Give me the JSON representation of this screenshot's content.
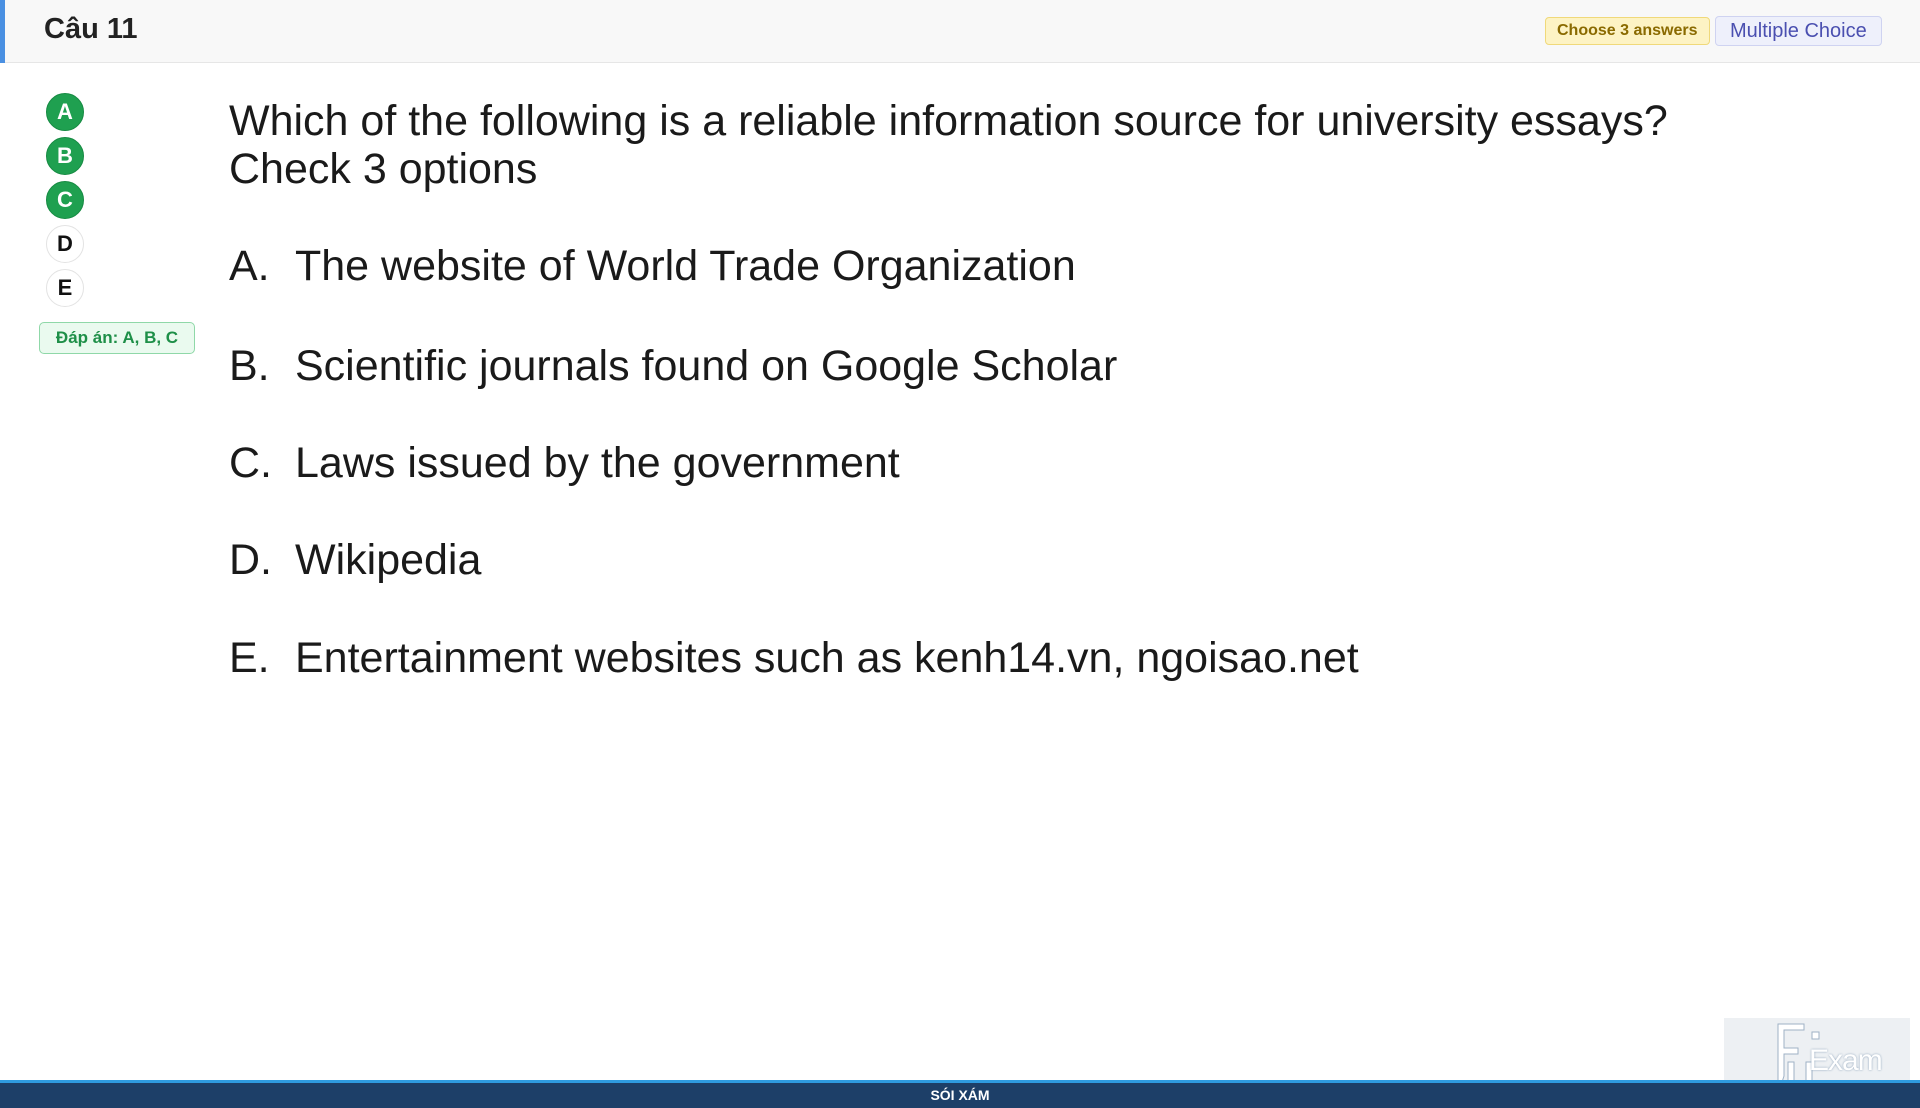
{
  "header": {
    "title": "Câu 11",
    "choose_label": "Choose 3 answers",
    "type_label": "Multiple Choice",
    "accent_color": "#4a90e2"
  },
  "answers": {
    "circles": [
      {
        "letter": "A",
        "selected": true
      },
      {
        "letter": "B",
        "selected": true
      },
      {
        "letter": "C",
        "selected": true
      },
      {
        "letter": "D",
        "selected": false
      },
      {
        "letter": "E",
        "selected": false
      }
    ],
    "badge": "Đáp án: A, B, C",
    "selected_color": "#1fa050"
  },
  "question": {
    "line1": "Which of the following is a reliable information source for university essays?",
    "line2": "Check 3 options",
    "options": [
      {
        "letter": "A.",
        "text": "The website of World Trade Organization"
      },
      {
        "letter": "B.",
        "text": "Scientific journals found on Google Scholar"
      },
      {
        "letter": "C.",
        "text": "Laws issued by the government"
      },
      {
        "letter": "D.",
        "text": "Wikipedia"
      },
      {
        "letter": "E.",
        "text": "Entertainment websites such as kenh14.vn, ngoisao.net"
      }
    ]
  },
  "footer": {
    "text": "SÓI XÁM",
    "color": "#1d3f68"
  },
  "logo": {
    "icon": "fu-exam-logo-icon",
    "text": "Exam"
  }
}
